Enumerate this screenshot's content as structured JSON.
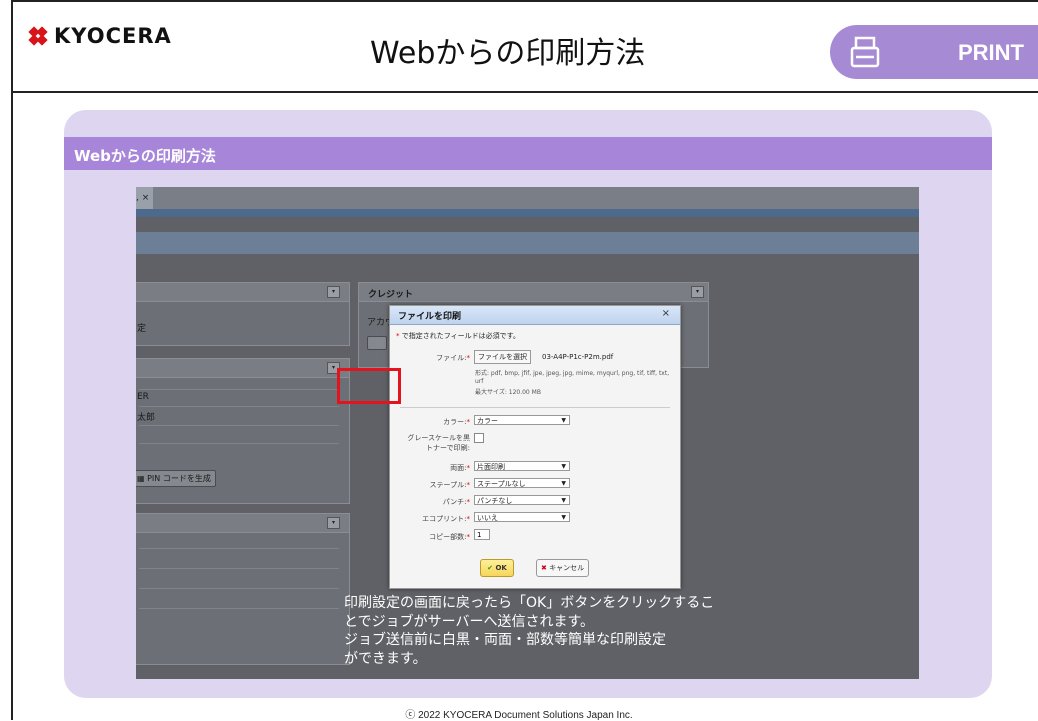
{
  "header": {
    "logo_text": "KYOCERA",
    "title": "Webからの印刷方法",
    "print_label": "PRINT",
    "print_icon": "printer-icon",
    "accent_color": "#a68ad4"
  },
  "panel": {
    "heading": "Webからの印刷方法",
    "heading_color": "#a785d9",
    "background_color": "#ded5f0"
  },
  "screenshot": {
    "tab_close": ", ×",
    "credit_panel_title": "クレジット",
    "credit_account_text": "アカウ",
    "left_text_1": "定",
    "left_text_2": "ER",
    "left_text_3": "太郎",
    "pin_button": "PIN コードを生成",
    "dialog": {
      "title": "ファイルを印刷",
      "close": "×",
      "required_note": "で指定されたフィールドは必須です。",
      "required_mark": "*",
      "file_label": "ファイル:",
      "file_button": "ファイルを選択",
      "file_name": "03-A4P-P1c-P2m.pdf",
      "formats_line1": "形式: pdf, bmp, jfif, jpe, jpeg, jpg, mime, myqurl, png, tif, tiff, txt,",
      "formats_line2": "urf",
      "max_size": "最大サイズ: 120.00 MB",
      "color_label": "カラー:",
      "color_value": "カラー",
      "grayscale_label_1": "グレースケールを黒",
      "grayscale_label_2": "トナーで印刷:",
      "duplex_label": "両面:",
      "duplex_value": "片面印刷",
      "staple_label": "ステープル:",
      "staple_value": "ステープルなし",
      "punch_label": "パンチ:",
      "punch_value": "パンチなし",
      "ecoprint_label": "エコプリント:",
      "ecoprint_value": "いいえ",
      "copies_label": "コピー部数:",
      "copies_value": "1",
      "ok_label": "OK",
      "cancel_label": "キャンセル"
    }
  },
  "caption": {
    "line1": "印刷設定の画面に戻ったら「OK」ボタンをクリックするこ",
    "line2": "とでジョブがサーバーへ送信されます。",
    "line3": "ジョブ送信前に白黒・両面・部数等簡単な印刷設定",
    "line4": "ができます。"
  },
  "footer": {
    "copyright": "ⓒ 2022 KYOCERA Document Solutions Japan Inc."
  },
  "colors": {
    "highlight": "#e4141e"
  }
}
